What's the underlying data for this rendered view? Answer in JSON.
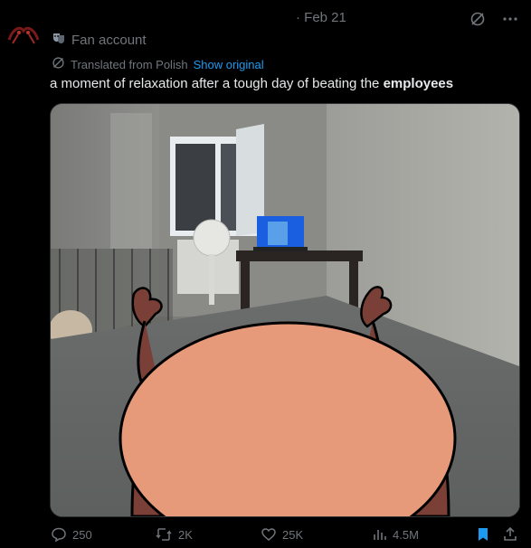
{
  "post": {
    "author_display": "Fan account",
    "date": "· Feb 21",
    "translation": {
      "note": "Translated from Polish",
      "show_original": "Show original"
    },
    "text_plain": "a moment of relaxation after a tough day of beating the ",
    "text_bold": "employees"
  },
  "media": {
    "alt": "photo"
  },
  "actions": {
    "replies": "250",
    "reposts": "2K",
    "likes": "25K",
    "views": "4.5M"
  },
  "colors": {
    "background": "#000000",
    "text": "#e7e9ea",
    "muted": "#71767b",
    "link": "#1d9bf0",
    "bookmark": "#1d9bf0"
  }
}
